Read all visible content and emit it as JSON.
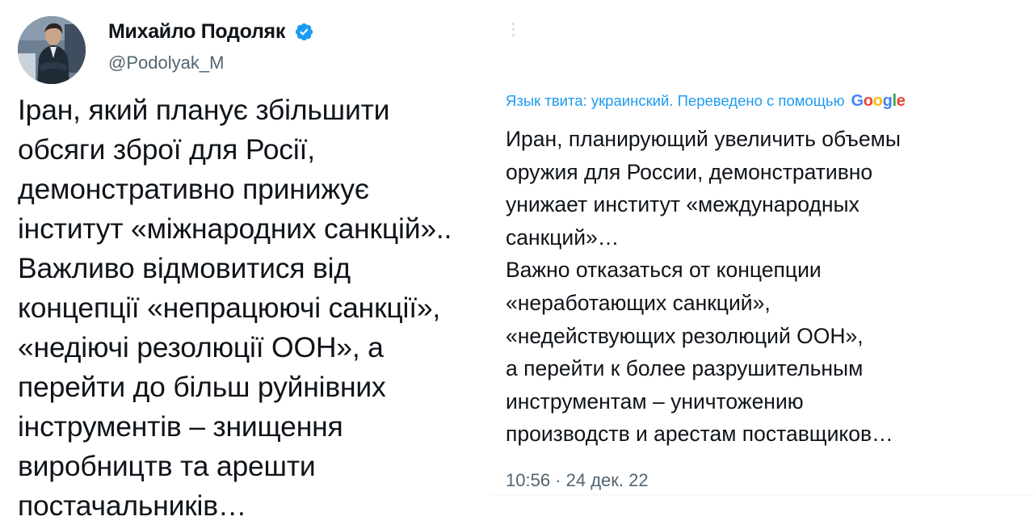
{
  "author": {
    "name": "Михайло Подоляк",
    "handle": "@Podolyak_M",
    "verified": true,
    "avatar_icon": "person-avatar-icon"
  },
  "tweet": {
    "text": "Іран, який планує збільшити\nобсяги зброї для Росії,\nдемонстративно принижує\nінститут «міжнародних санкцій»..\nВажливо відмовитися від\nконцепції «непрацюючі санкції»,\n«недіючі резолюції ООН», а\nперейти до більш руйнівних\nінструментів – знищення\nвиробництв та арешти\nпостачальників…"
  },
  "translation": {
    "note": "Язык твита: украинский. Переведено с помощью",
    "provider": "Google",
    "text": "Иран, планирующий увеличить объемы\nоружия для России, демонстративно\nунижает институт «международных\nсанкций»…\nВажно отказаться от концепции\n«неработающих санкций»,\n«недействующих резолюций ООН»,\nа перейти к более разрушительным\nинструментам – уничтожению\nпроизводств и арестам поставщиков…",
    "timestamp": "10:56 · 24 дек. 22"
  },
  "colors": {
    "text_primary": "#0f1419",
    "text_secondary": "#536471",
    "link_blue": "#1d9bf0",
    "verified_blue": "#1d9bf0"
  },
  "icons": {
    "verified": "verified-badge-icon",
    "more": "more-options-icon"
  }
}
